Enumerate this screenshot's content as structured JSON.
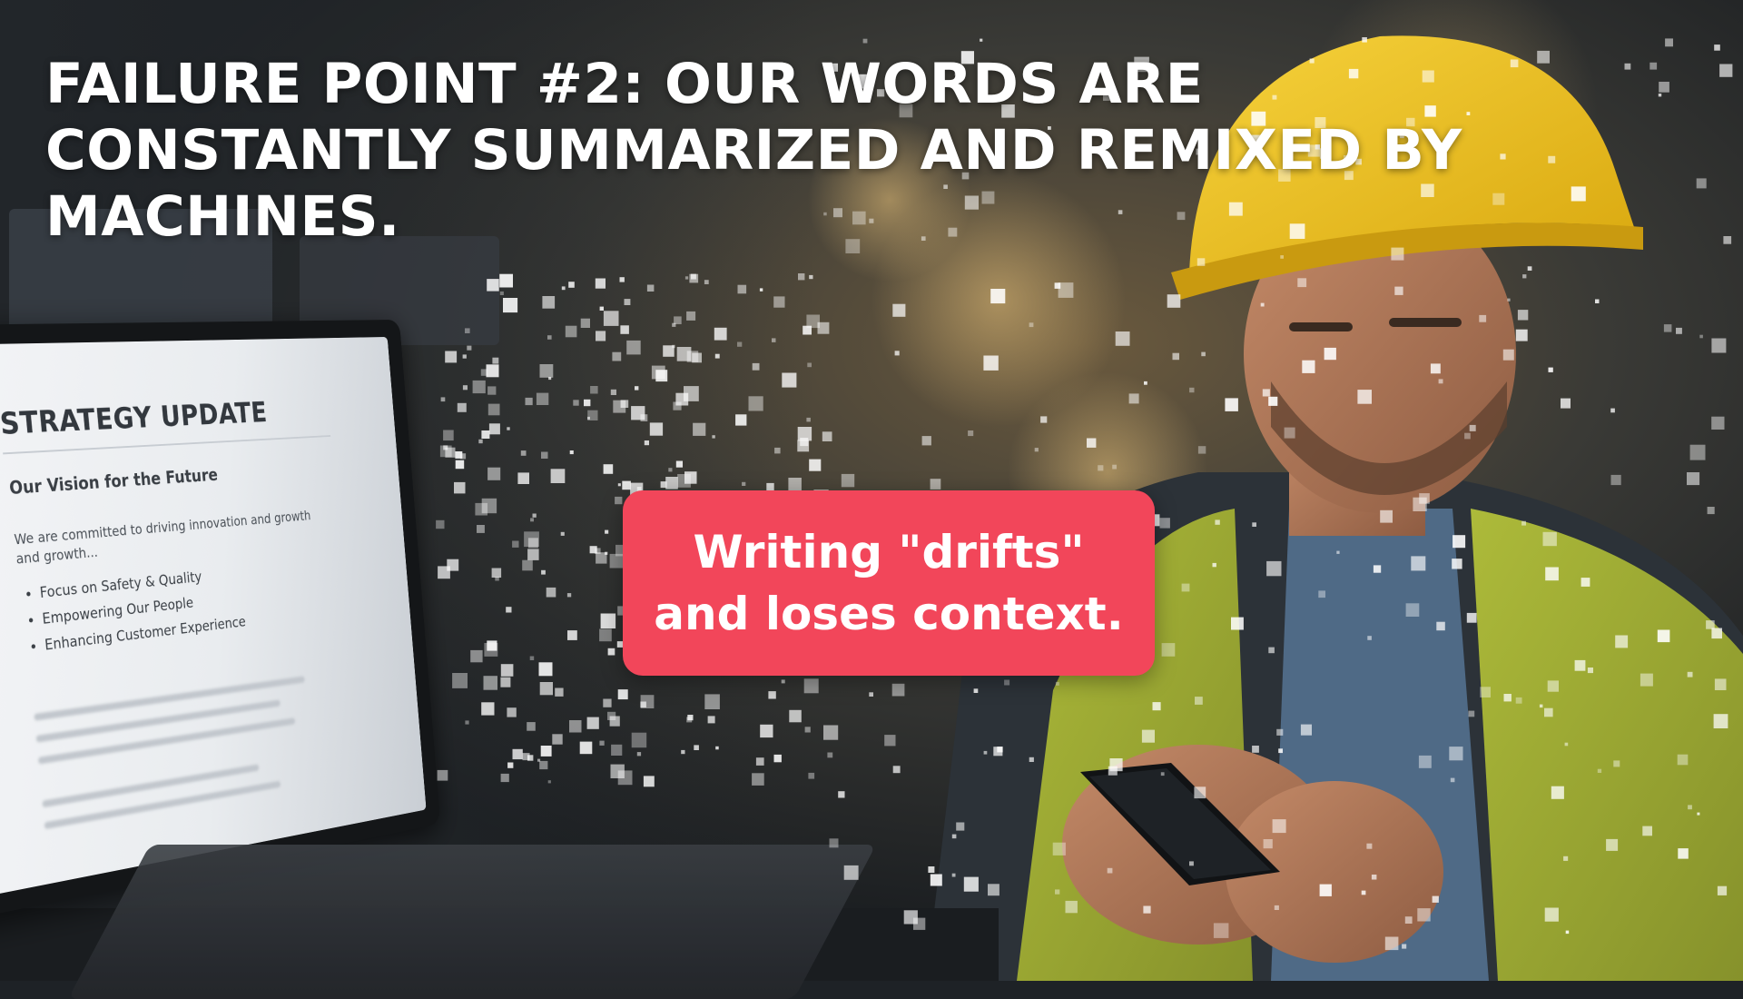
{
  "slide": {
    "headline": "FAILURE POINT #2:  OUR WORDS ARE CONSTANTLY SUMMARIZED AND REMIXED BY MACHINES.",
    "callout": {
      "line1": "Writing \"drifts\"",
      "line2": "and loses context."
    },
    "colors": {
      "callout_bg": "#f2465a",
      "headline_text": "#ffffff",
      "helmet": "#f0c21b",
      "vest": "#c9d43a"
    }
  },
  "laptop_document": {
    "title": "STRATEGY UPDATE",
    "subtitle": "Our Vision for the Future",
    "body": "We are committed to driving innovation and growth and growth...",
    "bullets": [
      "Focus on Safety & Quality",
      "Empowering Our People",
      "Enhancing Customer Experience"
    ]
  }
}
